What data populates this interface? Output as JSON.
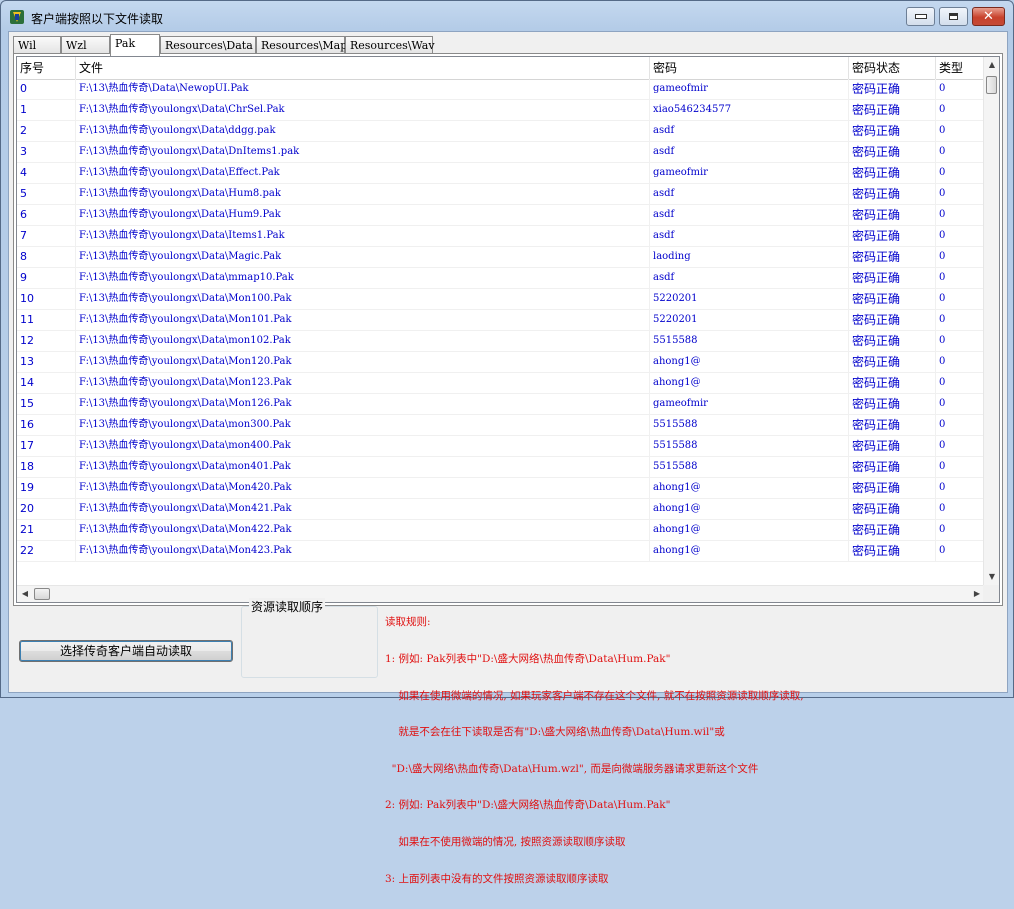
{
  "window": {
    "title": "客户端按照以下文件读取"
  },
  "tabs": [
    {
      "label": "Wil"
    },
    {
      "label": "Wzl"
    },
    {
      "label": "Pak"
    },
    {
      "label": "Resources\\Data"
    },
    {
      "label": "Resources\\Map"
    },
    {
      "label": "Resources\\Wav"
    }
  ],
  "active_tab": "Pak",
  "table": {
    "columns": [
      "序号",
      "文件",
      "密码",
      "密码状态",
      "类型"
    ],
    "rows": [
      [
        "0",
        "F:\\13\\热血传奇\\Data\\NewopUI.Pak",
        "gameofmir",
        "密码正确",
        "0"
      ],
      [
        "1",
        "F:\\13\\热血传奇\\youlongx\\Data\\ChrSel.Pak",
        "xiao546234577",
        "密码正确",
        "0"
      ],
      [
        "2",
        "F:\\13\\热血传奇\\youlongx\\Data\\ddgg.pak",
        "asdf",
        "密码正确",
        "0"
      ],
      [
        "3",
        "F:\\13\\热血传奇\\youlongx\\Data\\DnItems1.pak",
        "asdf",
        "密码正确",
        "0"
      ],
      [
        "4",
        "F:\\13\\热血传奇\\youlongx\\Data\\Effect.Pak",
        "gameofmir",
        "密码正确",
        "0"
      ],
      [
        "5",
        "F:\\13\\热血传奇\\youlongx\\Data\\Hum8.pak",
        "asdf",
        "密码正确",
        "0"
      ],
      [
        "6",
        "F:\\13\\热血传奇\\youlongx\\Data\\Hum9.Pak",
        "asdf",
        "密码正确",
        "0"
      ],
      [
        "7",
        "F:\\13\\热血传奇\\youlongx\\Data\\Items1.Pak",
        "asdf",
        "密码正确",
        "0"
      ],
      [
        "8",
        "F:\\13\\热血传奇\\youlongx\\Data\\Magic.Pak",
        "laoding",
        "密码正确",
        "0"
      ],
      [
        "9",
        "F:\\13\\热血传奇\\youlongx\\Data\\mmap10.Pak",
        "asdf",
        "密码正确",
        "0"
      ],
      [
        "10",
        "F:\\13\\热血传奇\\youlongx\\Data\\Mon100.Pak",
        "5220201",
        "密码正确",
        "0"
      ],
      [
        "11",
        "F:\\13\\热血传奇\\youlongx\\Data\\Mon101.Pak",
        "5220201",
        "密码正确",
        "0"
      ],
      [
        "12",
        "F:\\13\\热血传奇\\youlongx\\Data\\mon102.Pak",
        "5515588",
        "密码正确",
        "0"
      ],
      [
        "13",
        "F:\\13\\热血传奇\\youlongx\\Data\\Mon120.Pak",
        "ahong1@",
        "密码正确",
        "0"
      ],
      [
        "14",
        "F:\\13\\热血传奇\\youlongx\\Data\\Mon123.Pak",
        "ahong1@",
        "密码正确",
        "0"
      ],
      [
        "15",
        "F:\\13\\热血传奇\\youlongx\\Data\\Mon126.Pak",
        "gameofmir",
        "密码正确",
        "0"
      ],
      [
        "16",
        "F:\\13\\热血传奇\\youlongx\\Data\\mon300.Pak",
        "5515588",
        "密码正确",
        "0"
      ],
      [
        "17",
        "F:\\13\\热血传奇\\youlongx\\Data\\mon400.Pak",
        "5515588",
        "密码正确",
        "0"
      ],
      [
        "18",
        "F:\\13\\热血传奇\\youlongx\\Data\\mon401.Pak",
        "5515588",
        "密码正确",
        "0"
      ],
      [
        "19",
        "F:\\13\\热血传奇\\youlongx\\Data\\Mon420.Pak",
        "ahong1@",
        "密码正确",
        "0"
      ],
      [
        "20",
        "F:\\13\\热血传奇\\youlongx\\Data\\Mon421.Pak",
        "ahong1@",
        "密码正确",
        "0"
      ],
      [
        "21",
        "F:\\13\\热血传奇\\youlongx\\Data\\Mon422.Pak",
        "ahong1@",
        "密码正确",
        "0"
      ],
      [
        "22",
        "F:\\13\\热血传奇\\youlongx\\Data\\Mon423.Pak",
        "ahong1@",
        "密码正确",
        "0"
      ]
    ]
  },
  "bottom": {
    "auto_read_button": "选择传奇客户端自动读取",
    "group_label": "资源读取顺序",
    "rules": [
      "读取规则:",
      "1: 例如: Pak列表中\"D:\\盛大网络\\热血传奇\\Data\\Hum.Pak\"",
      "    如果在使用微端的情况, 如果玩家客户端不存在这个文件, 就不在按照资源读取顺序读取,",
      "    就是不会在往下读取是否有\"D:\\盛大网络\\热血传奇\\Data\\Hum.wil\"或",
      "  \"D:\\盛大网络\\热血传奇\\Data\\Hum.wzl\", 而是向微端服务器请求更新这个文件",
      "2: 例如: Pak列表中\"D:\\盛大网络\\热血传奇\\Data\\Hum.Pak\"",
      "    如果在不使用微端的情况, 按照资源读取顺序读取",
      "3: 上面列表中没有的文件按照资源读取顺序读取"
    ]
  },
  "colors": {
    "cell_text": "#0000cc",
    "rules_text": "#e01010"
  }
}
